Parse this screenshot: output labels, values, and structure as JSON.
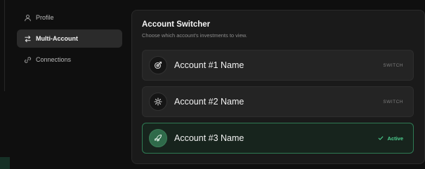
{
  "sidebar": {
    "items": [
      {
        "label": "Profile",
        "icon": "user-icon",
        "active": false
      },
      {
        "label": "Multi-Account",
        "icon": "swap-arrows-icon",
        "active": true
      },
      {
        "label": "Connections",
        "icon": "link-icon",
        "active": false
      }
    ]
  },
  "panel": {
    "title": "Account Switcher",
    "subtitle": "Choose which account's investments to view."
  },
  "accounts": [
    {
      "name": "Account #1 Name",
      "action": "SWITCH",
      "icon": "target-icon",
      "active": false
    },
    {
      "name": "Account #2 Name",
      "action": "SWITCH",
      "icon": "gear-icon",
      "active": false
    },
    {
      "name": "Account #3 Name",
      "status": "Active",
      "icon": "rocket-icon",
      "active": true
    }
  ],
  "colors": {
    "background": "#0f0f0f",
    "panel": "#1a1a1a",
    "card": "#242424",
    "accent": "#4ccf8f",
    "active_border": "#2f7a54"
  }
}
